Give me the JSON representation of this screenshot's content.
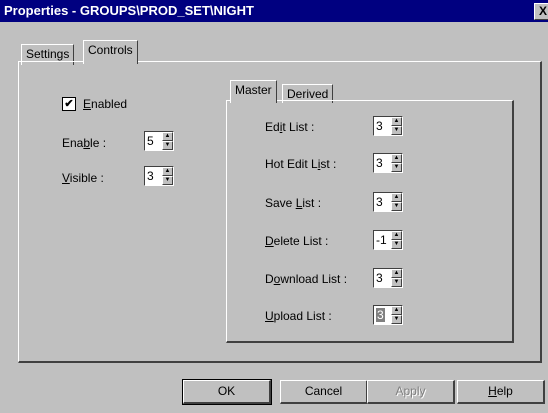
{
  "window": {
    "title": "Properties - GROUPS\\PROD_SET\\NIGHT",
    "close_glyph": "X"
  },
  "tabs": [
    {
      "label": "Settings"
    },
    {
      "label": "Controls",
      "active": true
    }
  ],
  "controls": {
    "enabled": {
      "label_prefix": "",
      "label_mnemonic": "E",
      "label_rest": "nabled",
      "checked": true,
      "check_glyph": "✔"
    },
    "enable": {
      "label_prefix": "Ena",
      "label_mnemonic": "b",
      "label_rest": "le :",
      "value": "5"
    },
    "visible": {
      "label_prefix": "",
      "label_mnemonic": "V",
      "label_rest": "isible :",
      "value": "3"
    }
  },
  "subtabs": [
    {
      "label": "Master",
      "active": true
    },
    {
      "label": "Derived"
    }
  ],
  "lists": [
    {
      "label_prefix": "Ed",
      "label_mnemonic": "i",
      "label_rest": "t List :",
      "value": "3"
    },
    {
      "label_prefix": "Hot Edit L",
      "label_mnemonic": "i",
      "label_rest": "st :",
      "value": "3"
    },
    {
      "label_prefix": "Save ",
      "label_mnemonic": "L",
      "label_rest": "ist :",
      "value": "3"
    },
    {
      "label_prefix": "",
      "label_mnemonic": "D",
      "label_rest": "elete List :",
      "value": "-1"
    },
    {
      "label_prefix": "D",
      "label_mnemonic": "o",
      "label_rest": "wnload List :",
      "value": "3"
    },
    {
      "label_prefix": "",
      "label_mnemonic": "U",
      "label_rest": "pload List :",
      "value": "3"
    }
  ],
  "buttons": {
    "ok": "OK",
    "cancel": "Cancel",
    "apply": "Apply",
    "help_mnemonic": "H",
    "help_rest": "elp"
  },
  "icons": {
    "spin_up": "▲",
    "spin_down": "▼"
  }
}
